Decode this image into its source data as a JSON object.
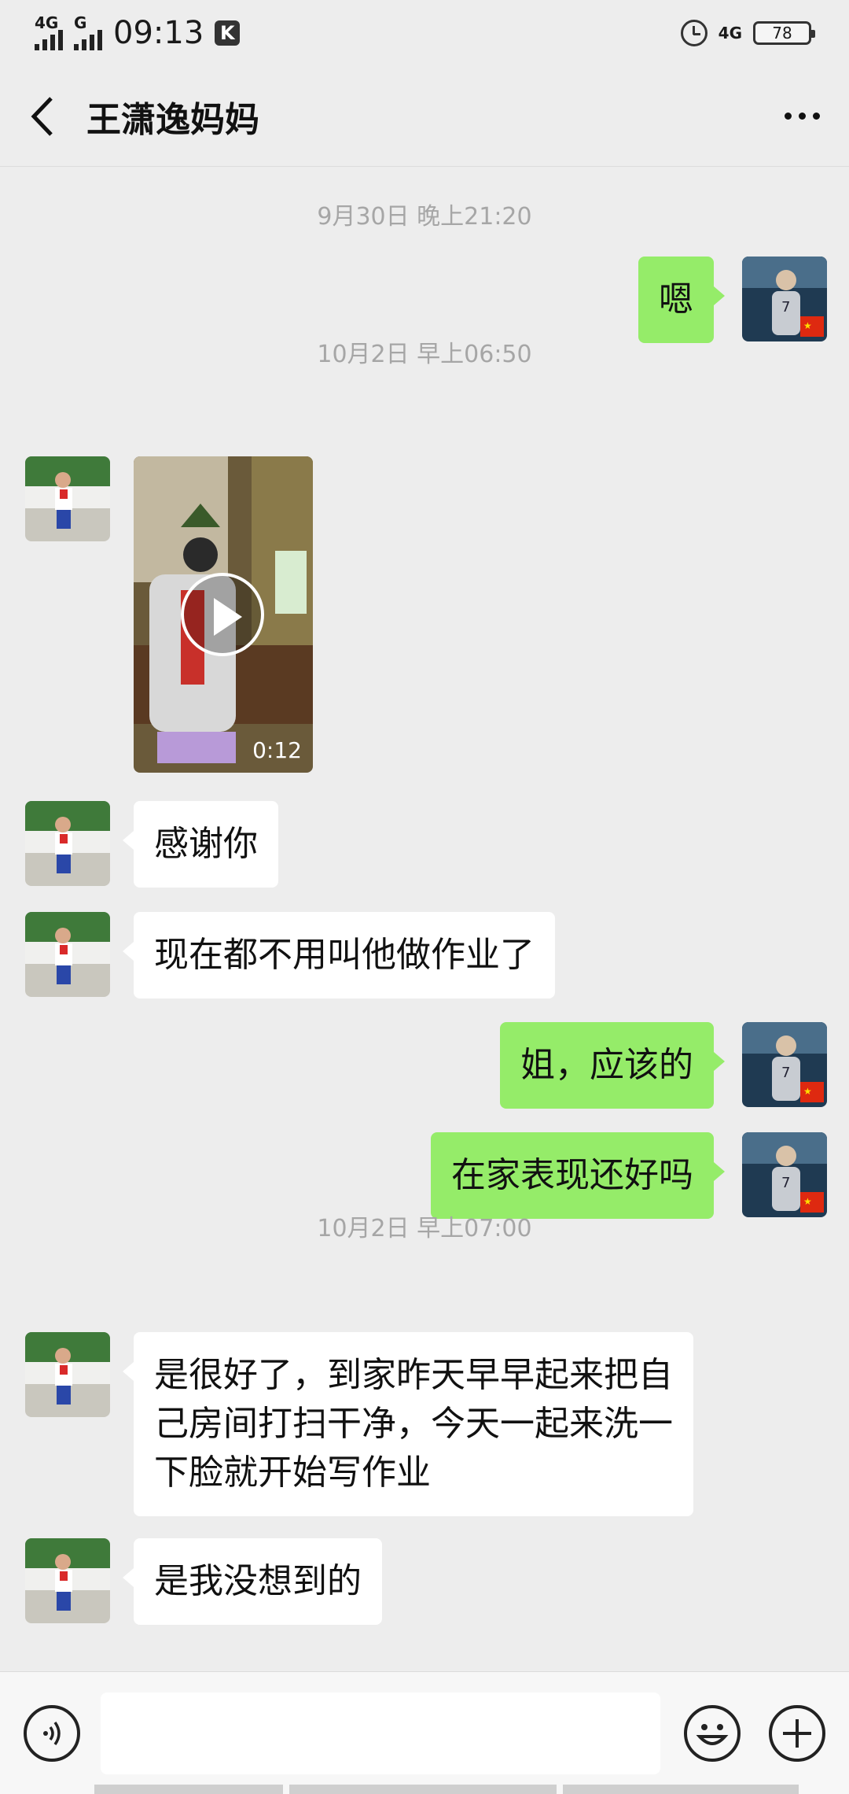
{
  "status_bar": {
    "net_left_1": "4G",
    "net_left_2": "G",
    "time": "09:13",
    "k_badge": "K",
    "net_right": "4G",
    "battery": "78"
  },
  "header": {
    "title": "王潇逸妈妈"
  },
  "messages": {
    "ts1": "9月30日 晚上21:20",
    "m1": "嗯",
    "ts2": "10月2日 早上06:50",
    "video_duration": "0:12",
    "m2": "感谢你",
    "m3": "现在都不用叫他做作业了",
    "m4": "姐，应该的",
    "m5": "在家表现还好吗",
    "ts3": "10月2日 早上07:00",
    "m6_line1": "是很好了，到家昨天早早起来把自",
    "m6_line2": "己房间打扫干净，今天一起来洗一",
    "m6_line3": "下脸就开始写作业",
    "m7": "是我没想到的"
  },
  "colors": {
    "out_bubble": "#95ec69",
    "in_bubble": "#ffffff",
    "background": "#ededed"
  },
  "icons": [
    "back-arrow-icon",
    "more-icon",
    "voice-icon",
    "emoji-icon",
    "plus-icon",
    "play-icon",
    "alarm-icon",
    "battery-icon",
    "signal-icon"
  ]
}
